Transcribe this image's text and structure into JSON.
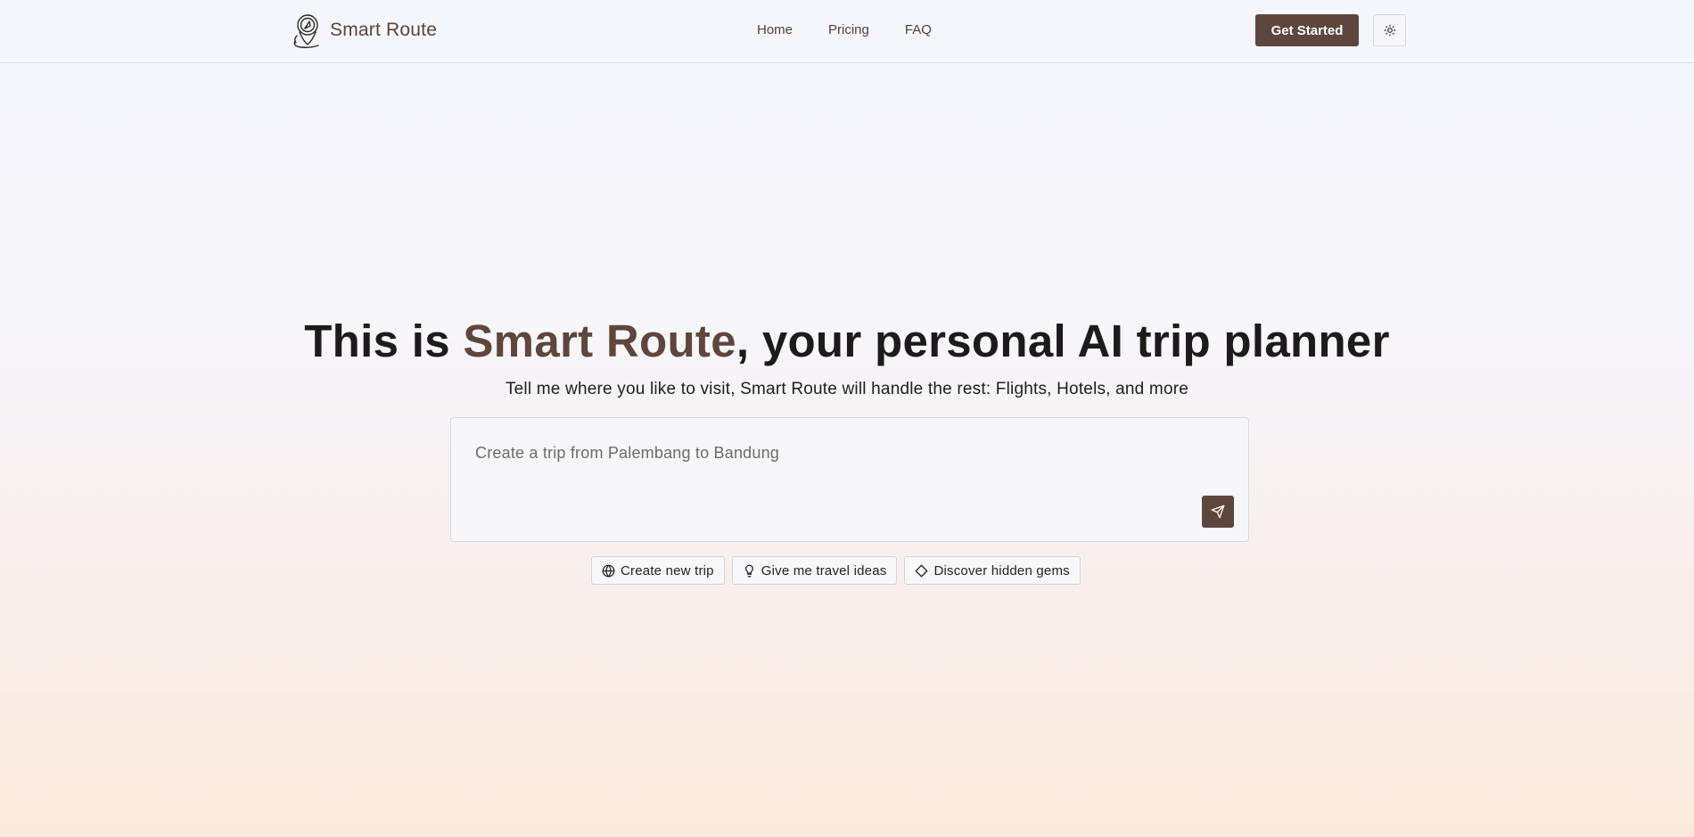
{
  "header": {
    "brand": "Smart Route",
    "nav": [
      {
        "label": "Home"
      },
      {
        "label": "Pricing"
      },
      {
        "label": "FAQ"
      }
    ],
    "cta_label": "Get Started",
    "theme_icon": "sun-icon"
  },
  "hero": {
    "title_prefix": "This is ",
    "title_accent": "Smart Route",
    "title_suffix": ", your personal AI trip planner",
    "subtitle": "Tell me where you like to visit, Smart Route will handle the rest: Flights, Hotels, and more"
  },
  "prompt": {
    "placeholder": "Create a trip from Palembang to Bandung",
    "value": "",
    "send_icon": "send-icon"
  },
  "suggestions": [
    {
      "label": "Create new trip",
      "icon": "globe-icon"
    },
    {
      "label": "Give me travel ideas",
      "icon": "lightbulb-icon"
    },
    {
      "label": "Discover hidden gems",
      "icon": "diamond-icon"
    }
  ],
  "colors": {
    "brand": "#5e463d",
    "text": "#1d1a1c",
    "background_top": "#f6f7fc",
    "background_bottom": "#fbe9dc"
  }
}
